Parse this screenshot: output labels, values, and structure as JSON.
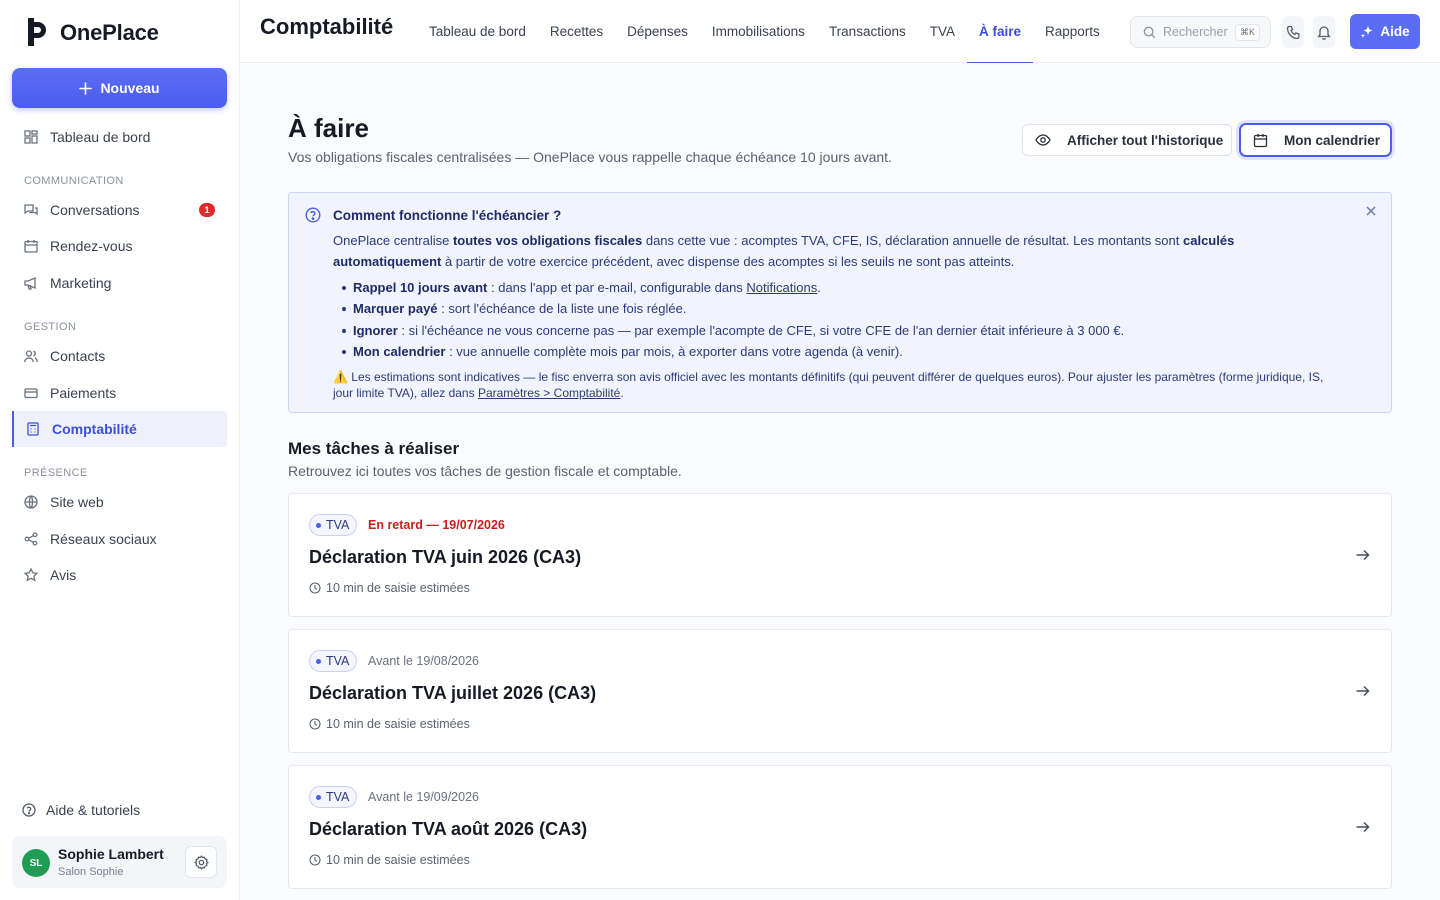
{
  "app": {
    "name": "OnePlace"
  },
  "sidebar": {
    "new_button": "Nouveau",
    "dashboard": "Tableau de bord",
    "sections": [
      {
        "label": "COMMUNICATION"
      },
      {
        "label": "GESTION"
      },
      {
        "label": "PRÉSENCE"
      }
    ],
    "items": [
      {
        "label": "Conversations",
        "badge": "1"
      },
      {
        "label": "Rendez-vous"
      },
      {
        "label": "Marketing"
      },
      {
        "label": "Contacts"
      },
      {
        "label": "Paiements"
      },
      {
        "label": "Comptabilité"
      },
      {
        "label": "Site web"
      },
      {
        "label": "Réseaux sociaux"
      },
      {
        "label": "Avis"
      }
    ],
    "help": "Aide & tutoriels",
    "user": {
      "initials": "SL",
      "name": "Sophie Lambert",
      "business": "Salon Sophie"
    }
  },
  "topbar": {
    "title": "Comptabilité",
    "tabs": [
      {
        "label": "Tableau de bord"
      },
      {
        "label": "Recettes"
      },
      {
        "label": "Dépenses"
      },
      {
        "label": "Immobilisations"
      },
      {
        "label": "Transactions"
      },
      {
        "label": "TVA"
      },
      {
        "label": "À faire"
      },
      {
        "label": "Rapports"
      }
    ],
    "active_tab": "À faire",
    "search_placeholder": "Rechercher",
    "search_shortcut": "⌘K",
    "aide_button": "Aide"
  },
  "page": {
    "title": "À faire",
    "subtitle": "Vos obligations fiscales centralisées — OnePlace vous rappelle chaque échéance 10 jours avant.",
    "history_button": "Afficher tout l'historique",
    "calendar_button": "Mon calendrier"
  },
  "info": {
    "title": "Comment fonctionne l'échéancier ?",
    "para_1": "OnePlace centralise ",
    "para_bold_1": "toutes vos obligations fiscales",
    "para_2": " dans cette vue : acomptes TVA, CFE, IS, déclaration annuelle de résultat. Les montants sont ",
    "para_bold_2": "calculés automatiquement",
    "para_3": " à partir de votre exercice précédent, avec dispense des acomptes si les seuils ne sont pas atteints.",
    "bullets": [
      {
        "bold": "Rappel 10 jours avant",
        "text": " : dans l'app et par e-mail, configurable dans ",
        "link": "Notifications",
        "tail": "."
      },
      {
        "bold": "Marquer payé",
        "text": " : sort l'échéance de la liste une fois réglée."
      },
      {
        "bold": "Ignorer",
        "text": " : si l'échéance ne vous concerne pas — par exemple l'acompte de CFE, si votre CFE de l'an dernier était inférieure à 3 000 €."
      },
      {
        "bold": "Mon calendrier",
        "text": " : vue annuelle complète mois par mois, à exporter dans votre agenda (à venir)."
      }
    ],
    "warning_icon": "⚠️",
    "warning_text": " Les estimations sont indicatives — le fisc enverra son avis officiel avec les montants définitifs (qui peuvent différer de quelques euros). Pour ajuster les paramètres (forme juridique, IS, jour limite TVA), allez dans ",
    "warning_link": "Paramètres > Comptabilité",
    "warning_tail": "."
  },
  "tasks": {
    "title": "Mes tâches à réaliser",
    "subtitle": "Retrouvez ici toutes vos tâches de gestion fiscale et comptable.",
    "items": [
      {
        "tag": "TVA",
        "due": "En retard — 19/07/2026",
        "late": true,
        "title": "Déclaration TVA juin 2026 (CA3)",
        "meta": "10 min de saisie estimées"
      },
      {
        "tag": "TVA",
        "due": "Avant le 19/08/2026",
        "late": false,
        "title": "Déclaration TVA juillet 2026 (CA3)",
        "meta": "10 min de saisie estimées"
      },
      {
        "tag": "TVA",
        "due": "Avant le 19/09/2026",
        "late": false,
        "title": "Déclaration TVA août 2026 (CA3)",
        "meta": "10 min de saisie estimées"
      }
    ]
  },
  "colors": {
    "accent": "#4b5cf0",
    "late": "#c81e1e",
    "info_bg": "#f1f4fe",
    "avatar": "#1f9d55"
  }
}
